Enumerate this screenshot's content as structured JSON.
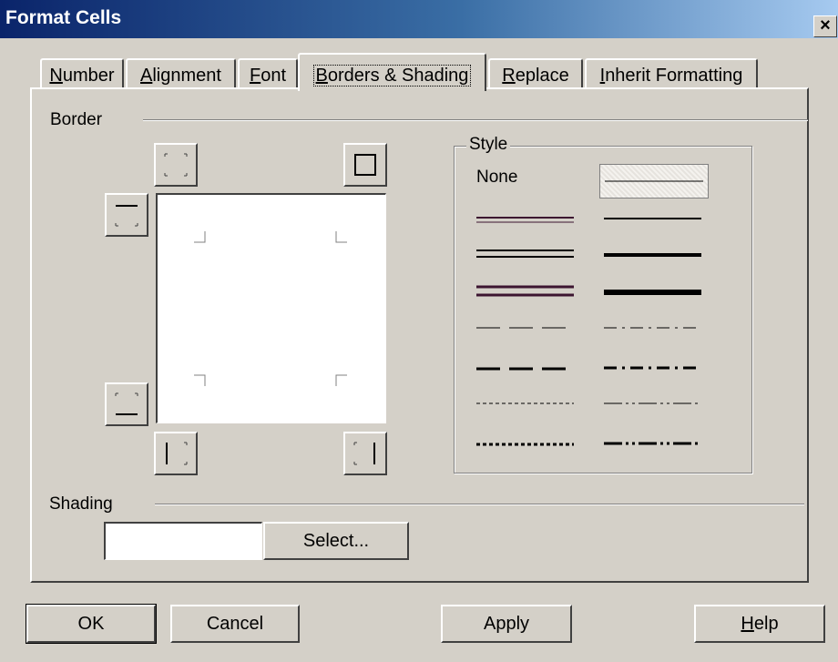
{
  "window": {
    "title": "Format Cells",
    "close_glyph": "×"
  },
  "tabs": [
    {
      "label": "Number",
      "mnemonic": "N",
      "rest": "umber"
    },
    {
      "label": "Alignment",
      "mnemonic": "A",
      "rest": "lignment"
    },
    {
      "label": "Font",
      "mnemonic": "F",
      "rest": "ont"
    },
    {
      "label": "Borders & Shading",
      "mnemonic": "B",
      "rest": "orders & Shading",
      "selected": true
    },
    {
      "label": "Replace",
      "mnemonic": "R",
      "rest": "eplace"
    },
    {
      "label": "Inherit Formatting",
      "mnemonic": "I",
      "rest": "nherit Formatting"
    }
  ],
  "border": {
    "section_label": "Border",
    "presets": [
      {
        "name": "no-border-icon"
      },
      {
        "name": "outline-border-icon"
      },
      {
        "name": "top-border-icon"
      },
      {
        "name": "bottom-border-icon"
      },
      {
        "name": "left-border-icon"
      },
      {
        "name": "right-border-icon"
      }
    ]
  },
  "style": {
    "group_label": "Style",
    "none_label": "None",
    "line_styles": [
      "thin-solid",
      "double-thin",
      "medium-solid",
      "double-medium",
      "thick-solid",
      "double-thick",
      "thickest-solid",
      "dash-thin",
      "dash-dot-thin",
      "dash-medium",
      "dash-dot-medium",
      "dotted-thin",
      "dash-dot-dot-thin",
      "dotted-medium",
      "dash-dot-dot-medium"
    ],
    "selected": "thin-solid"
  },
  "shading": {
    "section_label": "Shading",
    "select_button": "Select...",
    "color": "#ffffff"
  },
  "buttons": {
    "ok": "OK",
    "cancel": "Cancel",
    "apply": "Apply",
    "help_mnemonic": "H",
    "help_rest": "elp"
  },
  "colors": {
    "titlebar_start": "#0a246a",
    "titlebar_end": "#a6caf0",
    "dialog_face": "#d4d0c8",
    "double_line_accent": "#3c1430"
  }
}
